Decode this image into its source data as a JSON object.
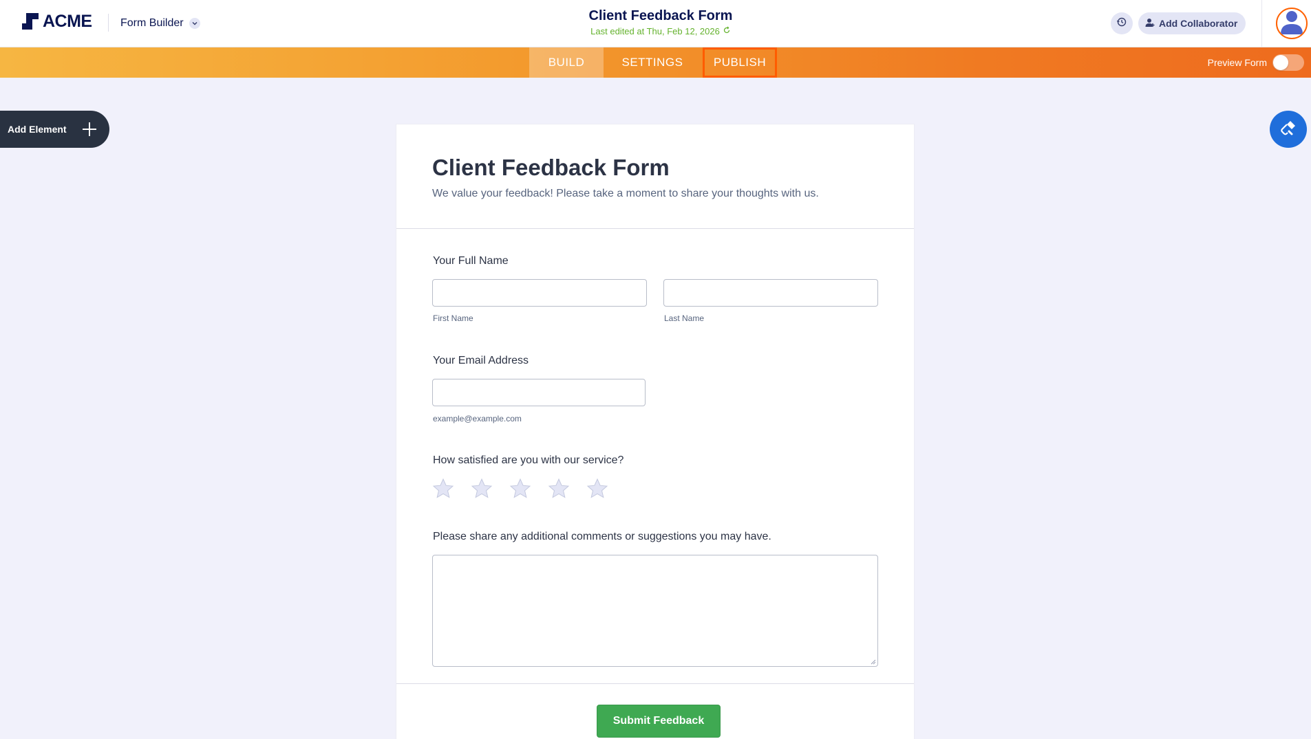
{
  "header": {
    "logo_text": "ACME",
    "app_switch_label": "Form Builder",
    "doc_title": "Client Feedback Form",
    "last_edited": "Last edited at Thu, Feb 12, 2026",
    "add_collaborator_label": "Add Collaborator"
  },
  "nav": {
    "tabs": [
      {
        "label": "BUILD",
        "state": "active"
      },
      {
        "label": "SETTINGS",
        "state": "default"
      },
      {
        "label": "PUBLISH",
        "state": "highlighted"
      }
    ],
    "preview_label": "Preview Form",
    "preview_enabled": false
  },
  "sidebar": {
    "add_element_label": "Add Element"
  },
  "form": {
    "title": "Client Feedback Form",
    "subtitle": "We value your feedback! Please take a moment to share your thoughts with us.",
    "name_question": "Your Full Name",
    "first_name_sublabel": "First Name",
    "last_name_sublabel": "Last Name",
    "first_name_value": "",
    "last_name_value": "",
    "email_question": "Your Email Address",
    "email_sublabel": "example@example.com",
    "email_value": "",
    "rating_question": "How satisfied are you with our service?",
    "rating_max": 5,
    "rating_value": 0,
    "comments_question": "Please share any additional comments or suggestions you may have.",
    "comments_value": "",
    "submit_label": "Submit Feedback"
  },
  "icons": {
    "logo": "acme-logo-icon",
    "app_switch": "chevron-down-icon",
    "refresh": "refresh-icon",
    "history": "history-icon",
    "collaborator": "add-user-icon",
    "avatar": "user-avatar-icon",
    "add": "plus-icon",
    "designer": "paint-roller-icon",
    "star": "star-icon"
  },
  "colors": {
    "brand_navy": "#0a1551",
    "nav_gradient_start": "#f6b642",
    "nav_gradient_end": "#ee6b1e",
    "publish_outline": "#ff5c00",
    "edited_green": "#64b22d",
    "submit_green": "#3fa952",
    "designer_blue": "#1f6edb",
    "add_element_bg": "#293241",
    "canvas_bg": "#f1f1fb"
  }
}
